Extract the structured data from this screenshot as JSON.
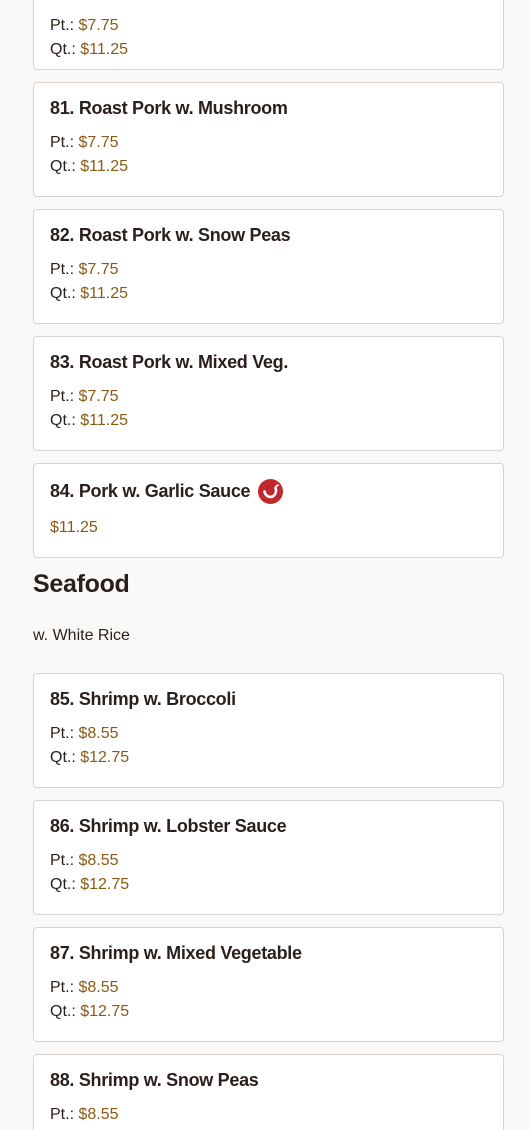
{
  "items": {
    "item_80": {
      "pt_label": "Pt.:",
      "pt_price": "$7.75",
      "qt_label": "Qt.:",
      "qt_price": "$11.25"
    },
    "item_81": {
      "name": "81. Roast Pork w. Mushroom",
      "pt_label": "Pt.:",
      "pt_price": "$7.75",
      "qt_label": "Qt.:",
      "qt_price": "$11.25"
    },
    "item_82": {
      "name": "82. Roast Pork w. Snow Peas",
      "pt_label": "Pt.:",
      "pt_price": "$7.75",
      "qt_label": "Qt.:",
      "qt_price": "$11.25"
    },
    "item_83": {
      "name": "83. Roast Pork w. Mixed Veg.",
      "pt_label": "Pt.:",
      "pt_price": "$7.75",
      "qt_label": "Qt.:",
      "qt_price": "$11.25"
    },
    "item_84": {
      "name": "84. Pork w. Garlic Sauce",
      "price": "$11.25",
      "icon": "spicy-pepper-icon"
    },
    "item_85": {
      "name": "85. Shrimp w. Broccoli",
      "pt_label": "Pt.:",
      "pt_price": "$8.55",
      "qt_label": "Qt.:",
      "qt_price": "$12.75"
    },
    "item_86": {
      "name": "86. Shrimp w. Lobster Sauce",
      "pt_label": "Pt.:",
      "pt_price": "$8.55",
      "qt_label": "Qt.:",
      "qt_price": "$12.75"
    },
    "item_87": {
      "name": "87. Shrimp w. Mixed Vegetable",
      "pt_label": "Pt.:",
      "pt_price": "$8.55",
      "qt_label": "Qt.:",
      "qt_price": "$12.75"
    },
    "item_88": {
      "name": "88. Shrimp w. Snow Peas",
      "pt_label": "Pt.:",
      "pt_price": "$8.55"
    }
  },
  "sections": {
    "seafood": {
      "title": "Seafood",
      "subtitle": "w. White Rice"
    }
  },
  "colors": {
    "price": "#8a5a14",
    "spicy_icon": "#c0282d",
    "card_border": "#d8d3ce",
    "background": "#faf9f7"
  }
}
